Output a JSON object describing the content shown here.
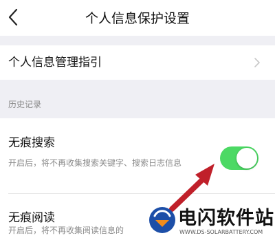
{
  "nav": {
    "title": "个人信息保护设置"
  },
  "guide_row": {
    "label": "个人信息管理指引"
  },
  "section_header": "历史记录",
  "items": [
    {
      "title": "无痕搜索",
      "desc": "开启后，将不再收集搜索关键字、搜索日志信息",
      "toggle_on": true
    },
    {
      "title": "无痕阅读",
      "desc": "开启后，将不再收集阅读信息的"
    }
  ],
  "colors": {
    "toggle_on": "#4cd964",
    "arrow": "#c0202a"
  },
  "watermark": {
    "name": "电闪软件站",
    "domain": "WWW.DS-SOLARBATTERY.COM"
  }
}
